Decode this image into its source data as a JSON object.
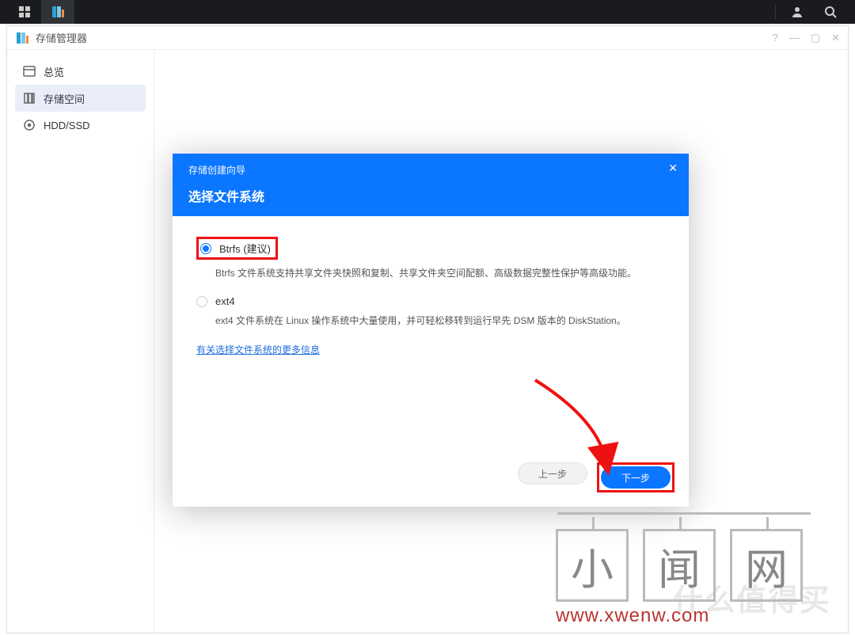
{
  "osbar": {
    "apps": "apps",
    "current_app": "storage-manager"
  },
  "window": {
    "title": "存储管理器"
  },
  "sidebar": {
    "items": [
      {
        "label": "总览"
      },
      {
        "label": "存储空间"
      },
      {
        "label": "HDD/SSD"
      }
    ]
  },
  "dialog": {
    "wizard_name": "存储创建向导",
    "title": "选择文件系统",
    "close_glyph": "✕",
    "options": [
      {
        "label": "Btrfs (建议)",
        "desc": "Btrfs 文件系统支持共享文件夹快照和复制、共享文件夹空间配额、高级数据完整性保护等高级功能。"
      },
      {
        "label": "ext4",
        "desc": "ext4 文件系统在 Linux 操作系统中大量使用，并可轻松移转到运行早先 DSM 版本的 DiskStation。"
      }
    ],
    "more_link": "有关选择文件系统的更多信息",
    "prev_label": "上一步",
    "next_label": "下一步"
  },
  "watermark": {
    "bg_text": "什么值得买",
    "chars": [
      "小",
      "闻",
      "网"
    ],
    "url": "www.xwenw.com"
  }
}
